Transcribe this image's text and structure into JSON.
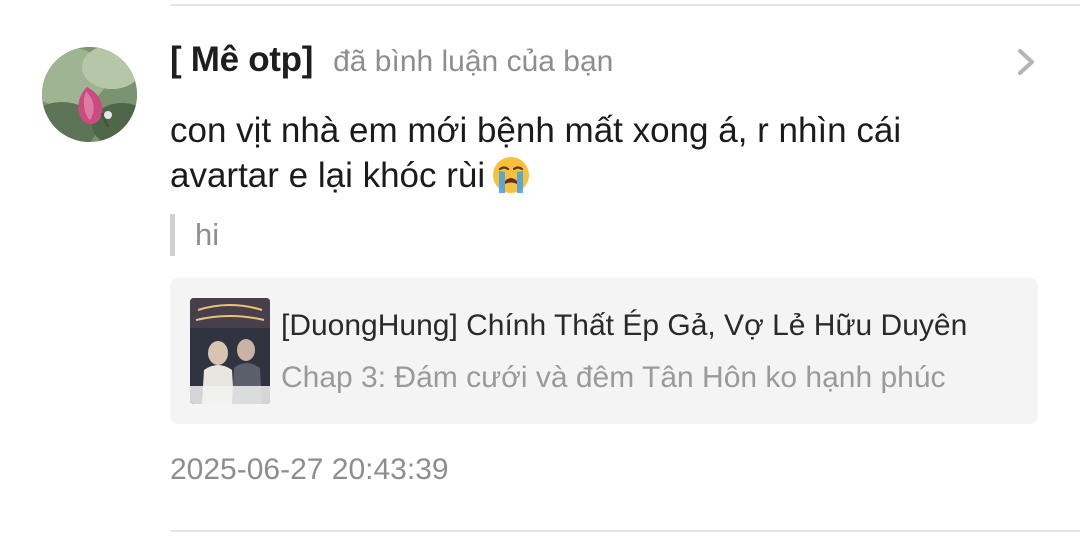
{
  "notification": {
    "username": "[ Mê otp]",
    "action": "đã bình luận của bạn",
    "comment_lines": [
      "con vịt nhà em mới bệnh mất xong á, r nhìn cái",
      "avartar e lại khóc rùi"
    ],
    "comment_emoji": "loudly-crying-face-emoji",
    "quoted_text": "hi",
    "story": {
      "title": "[DuongHung] Chính Thất Ép Gả, Vợ Lẻ Hữu Duyên",
      "chapter": "Chap 3: Đám cưới và đêm Tân Hôn ko hạnh phúc"
    },
    "timestamp": "2025-06-27 20:43:39",
    "open_icon": "chevron-right-icon"
  },
  "colors": {
    "username": "#1e1e1e",
    "secondary_text": "#8e8e8e",
    "card_background": "#f4f4f4",
    "divider": "#e6e6e6",
    "emoji_face": "#f7c13b",
    "emoji_tears": "#4aa3e8"
  }
}
